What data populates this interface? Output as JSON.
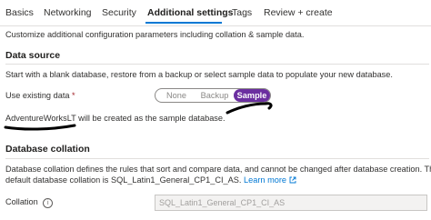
{
  "tabs": [
    {
      "label": "Basics"
    },
    {
      "label": "Networking"
    },
    {
      "label": "Security"
    },
    {
      "label": "Additional settings"
    },
    {
      "label": "Tags"
    },
    {
      "label": "Review + create"
    }
  ],
  "active_tab": "Additional settings",
  "intro": "Customize additional configuration parameters including collation & sample data.",
  "data_source": {
    "title": "Data source",
    "description": "Start with a blank database, restore from a backup or select sample data to populate your new database.",
    "use_existing_label": "Use existing data",
    "required_marker": "*",
    "options": [
      "None",
      "Backup",
      "Sample"
    ],
    "selected": "Sample",
    "sample_name": "AdventureWorksLT",
    "sample_note": " will be created as the sample database."
  },
  "collation": {
    "title": "Database collation",
    "description_line1": "Database collation defines the rules that sort and compare data, and cannot be changed after database creation. The",
    "description_line2": "default database collation is SQL_Latin1_General_CP1_CI_AS.",
    "learn_more": "Learn more",
    "learn_more_icon": "external-link-icon",
    "field_label": "Collation",
    "field_value": "SQL_Latin1_General_CP1_CI_AS"
  },
  "colors": {
    "accent": "#0078d4",
    "selected_option": "#6b2fa0",
    "annotation": "#000000"
  }
}
